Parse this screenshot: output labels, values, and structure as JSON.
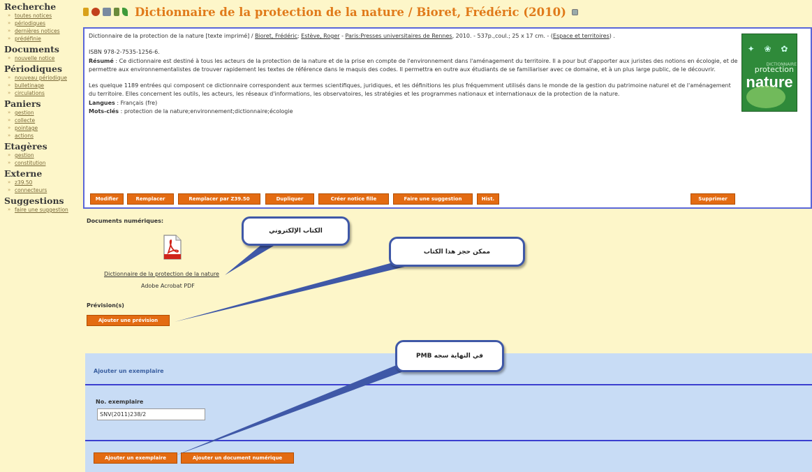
{
  "sidebar": {
    "sections": [
      {
        "title": "Recherche",
        "links": [
          "toutes notices",
          "périodiques",
          "dernières notices",
          "prédéfinie"
        ]
      },
      {
        "title": "Documents",
        "links": [
          "nouvelle notice"
        ]
      },
      {
        "title": "Périodiques",
        "links": [
          "nouveau périodique",
          "bulletinage",
          "circulations"
        ]
      },
      {
        "title": "Paniers",
        "links": [
          "gestion",
          "collecte",
          "pointage",
          "actions"
        ]
      },
      {
        "title": "Etagères",
        "links": [
          "gestion",
          "constitution"
        ]
      },
      {
        "title": "Externe",
        "links": [
          "z39.50",
          "connecteurs"
        ]
      },
      {
        "title": "Suggestions",
        "links": [
          "faire une suggestion"
        ]
      }
    ]
  },
  "header": {
    "title": "Dictionnaire de la protection de la nature / Bioret, Frédéric (2010)"
  },
  "notice": {
    "line1_prefix": "Dictionnaire de la protection de la nature [texte imprimé] / ",
    "author1": "Bioret, Frédéric",
    "author2": "Estève, Roger",
    "publisher": "Paris:Presses universitaires de Rennes",
    "line1_suffix": ", 2010. - 537p.,coul.; 25 x 17 cm. - (",
    "series": "Espace et territoires",
    "series_end": ") .",
    "isbn": "ISBN 978-2-7535-1256-6.",
    "summary_label": "Résumé",
    "summary": " : Ce dictionnaire est destiné à tous les acteurs de la protection de la nature et de la prise en compte de l'environnement dans l'aménagement du territoire. Il a pour but d'apporter aux juristes des notions en écologie, et de permettre aux environnementalistes de trouver rapidement les textes de référence dans le maquis des codes. Il permettra en outre aux étudiants de se familiariser avec ce domaine, et à un plus large public, de le découvrir.",
    "paragraph2": "Les quelque 1189 entrées qui composent ce dictionnaire correspondent aux termes scientifiques, juridiques, et les définitions les plus fréquemment utilisés dans le monde de la gestion du patrimoine naturel et de l'aménagement du territoire. Elles concernent les outils, les acteurs, les réseaux d'informations, les observatoires, les stratégies et les programmes nationaux et internationaux de la protection de la nature.",
    "languages_label": "Langues",
    "languages": " : Français (fre)",
    "keywords_label": "Mots-clés",
    "keywords": " : protection de la nature;environnement;dictionnaire;écologie",
    "cover": {
      "top": "✦ ❀ ✿",
      "small": "DICTIONNAIRE",
      "mid": "protection",
      "big": "nature"
    }
  },
  "actions": {
    "modify": "Modifier",
    "replace": "Remplacer",
    "replace_z3950": "Remplacer par Z39.50",
    "duplicate": "Dupliquer",
    "create_child": "Créer notice fille",
    "suggestion": "Faire une suggestion",
    "hist": "Hist.",
    "delete": "Supprimer"
  },
  "digital_docs": {
    "label": "Documents numériques:",
    "link": "Dictionnaire de la protection de la nature",
    "type": "Adobe Acrobat PDF"
  },
  "forecast": {
    "label": "Prévision(s)",
    "button": "Ajouter une prévision"
  },
  "copy": {
    "title": "Ajouter un exemplaire",
    "field_label": "No. exemplaire",
    "field_value": "SNV(2011)238/2",
    "add_button": "Ajouter un exemplaire",
    "add_doc_button": "Ajouter un document numérique"
  },
  "callouts": {
    "ebook": "الكتاب الإلكتروني",
    "reserve": "ممكن حجز هذا الكتاب",
    "end": "في النهاية سجه PMB"
  },
  "colors": {
    "accent_orange": "#e36b12",
    "title_orange": "#e07a1a",
    "panel_blue": "#c8dcf5",
    "border_blue": "#5a66d8"
  }
}
